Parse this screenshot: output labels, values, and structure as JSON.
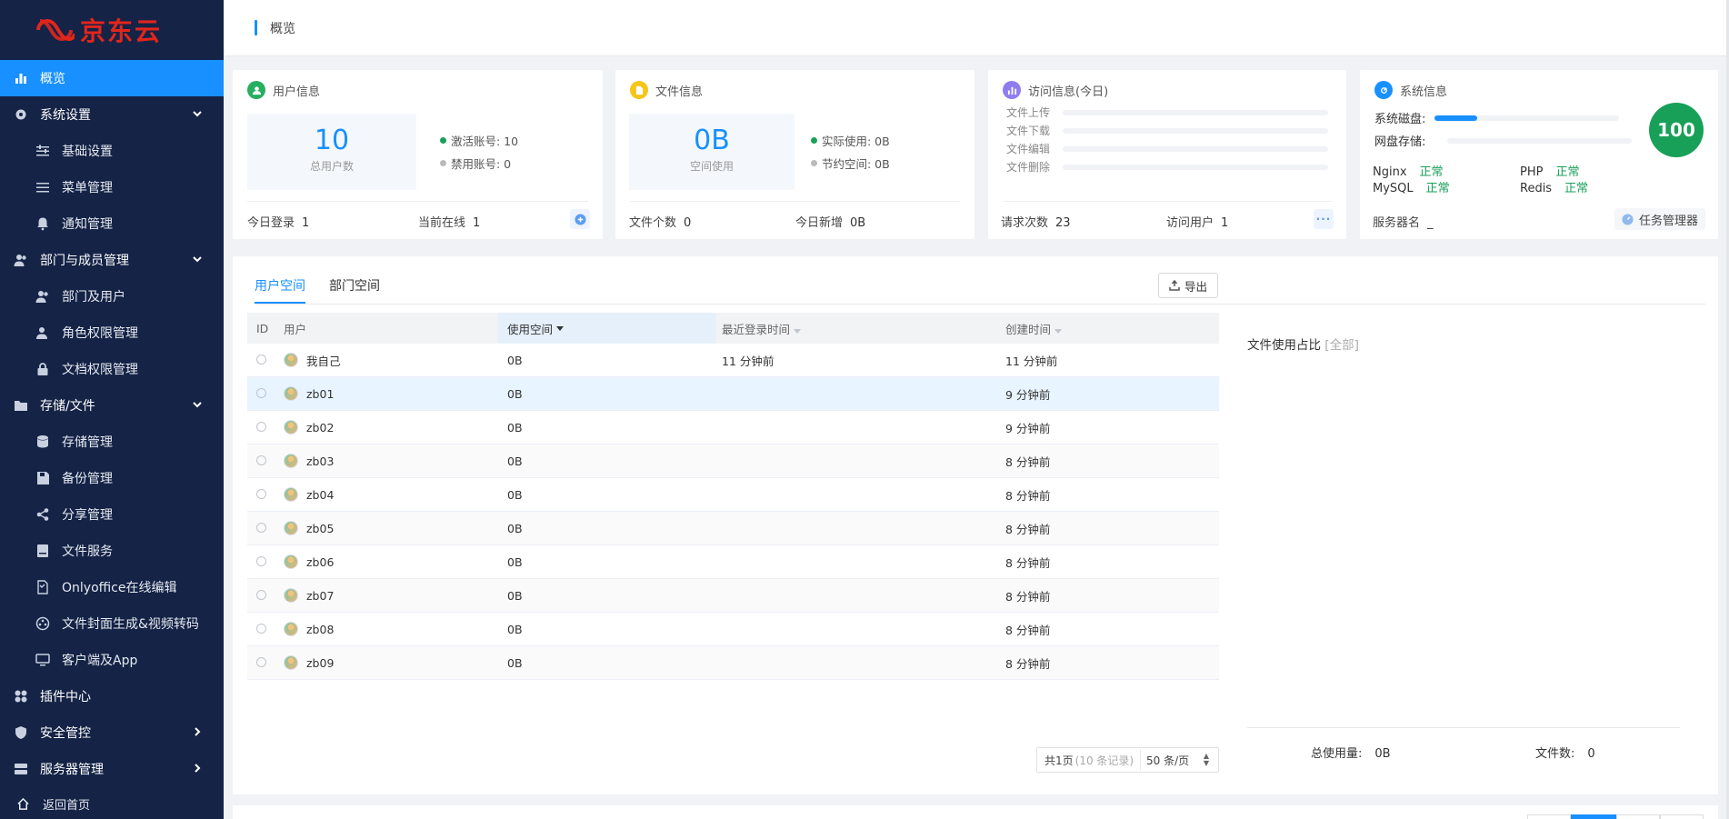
{
  "brand": {
    "name": "京东云",
    "color": "#e1261c"
  },
  "sidebar": {
    "items": [
      {
        "label": "概览",
        "icon": "bar-chart-icon",
        "active": true
      },
      {
        "label": "系统设置",
        "icon": "gear-icon",
        "expanded": true
      },
      {
        "label": "基础设置",
        "icon": "sliders-icon"
      },
      {
        "label": "菜单管理",
        "icon": "list-icon"
      },
      {
        "label": "通知管理",
        "icon": "bell-icon"
      },
      {
        "label": "部门与成员管理",
        "icon": "users-icon",
        "expanded": true
      },
      {
        "label": "部门及用户",
        "icon": "user-group-icon"
      },
      {
        "label": "角色权限管理",
        "icon": "user-shield-icon"
      },
      {
        "label": "文档权限管理",
        "icon": "lock-icon"
      },
      {
        "label": "存储/文件",
        "icon": "folder-icon",
        "expanded": true
      },
      {
        "label": "存储管理",
        "icon": "database-icon"
      },
      {
        "label": "备份管理",
        "icon": "save-icon"
      },
      {
        "label": "分享管理",
        "icon": "share-icon"
      },
      {
        "label": "文件服务",
        "icon": "hdd-icon"
      },
      {
        "label": "Onlyoffice在线编辑",
        "icon": "document-edit-icon"
      },
      {
        "label": "文件封面生成&视频转码",
        "icon": "film-icon"
      },
      {
        "label": "客户端及App",
        "icon": "monitor-icon"
      },
      {
        "label": "插件中心",
        "icon": "plugin-icon"
      },
      {
        "label": "安全管控",
        "icon": "shield-icon",
        "expanded": false
      },
      {
        "label": "服务器管理",
        "icon": "server-icon",
        "expanded": false
      }
    ],
    "back_home": "返回首页"
  },
  "header": {
    "title": "概览"
  },
  "cards": {
    "user": {
      "title": "用户信息",
      "total": "10",
      "total_label": "总用户数",
      "active_label": "激活账号: 10",
      "disabled_label": "禁用账号: 0",
      "today_login_label": "今日登录",
      "today_login": "1",
      "online_label": "当前在线",
      "online": "1"
    },
    "file": {
      "title": "文件信息",
      "space": "0B",
      "space_label": "空间使用",
      "actual_label": "实际使用: 0B",
      "saved_label": "节约空间: 0B",
      "count_label": "文件个数",
      "count": "0",
      "new_label": "今日新增",
      "new": "0B"
    },
    "access": {
      "title": "访问信息(今日)",
      "bars": [
        {
          "label": "文件上传",
          "value": 0
        },
        {
          "label": "文件下载",
          "value": 0
        },
        {
          "label": "文件编辑",
          "value": 0
        },
        {
          "label": "文件删除",
          "value": 0
        }
      ],
      "requests_label": "请求次数",
      "requests": "23",
      "visitors_label": "访问用户",
      "visitors": "1"
    },
    "system": {
      "title": "系统信息",
      "disk_label": "系统磁盘:",
      "disk_fill": 0.23,
      "netdisk_label": "网盘存储:",
      "netdisk_fill": 0,
      "services": [
        {
          "name": "Nginx",
          "status": "正常"
        },
        {
          "name": "PHP",
          "status": "正常"
        },
        {
          "name": "MySQL",
          "status": "正常"
        },
        {
          "name": "Redis",
          "status": "正常"
        }
      ],
      "score": "100",
      "server_label": "服务器名",
      "server_name": "_",
      "task_manager": "任务管理器"
    }
  },
  "main": {
    "tabs": [
      {
        "label": "用户空间",
        "active": true
      },
      {
        "label": "部门空间",
        "active": false
      }
    ],
    "export": "导出",
    "columns": [
      "ID",
      "用户",
      "使用空间",
      "最近登录时间",
      "创建时间"
    ],
    "rows": [
      {
        "user": "我自己",
        "used": "0B",
        "last": "11 分钟前",
        "created": "11 分钟前"
      },
      {
        "user": "zb01",
        "used": "0B",
        "last": "",
        "created": "9 分钟前"
      },
      {
        "user": "zb02",
        "used": "0B",
        "last": "",
        "created": "9 分钟前"
      },
      {
        "user": "zb03",
        "used": "0B",
        "last": "",
        "created": "8 分钟前"
      },
      {
        "user": "zb04",
        "used": "0B",
        "last": "",
        "created": "8 分钟前"
      },
      {
        "user": "zb05",
        "used": "0B",
        "last": "",
        "created": "8 分钟前"
      },
      {
        "user": "zb06",
        "used": "0B",
        "last": "",
        "created": "8 分钟前"
      },
      {
        "user": "zb07",
        "used": "0B",
        "last": "",
        "created": "8 分钟前"
      },
      {
        "user": "zb08",
        "used": "0B",
        "last": "",
        "created": "8 分钟前"
      },
      {
        "user": "zb09",
        "used": "0B",
        "last": "",
        "created": "8 分钟前"
      }
    ],
    "pager": {
      "pages": "共1页",
      "records": "(10 条记录)",
      "per_page": "50 条/页"
    },
    "panel": {
      "title": "文件使用占比",
      "filter": "[全部]",
      "total_label": "总使用量:",
      "total": "0B",
      "count_label": "文件数:",
      "count": "0"
    }
  },
  "colors": {
    "accent": "#1890ff",
    "sidebar_bg": "#142346",
    "ok": "#18a058",
    "user_icon": "#27ae60",
    "file_icon": "#f5c518",
    "access_icon": "#8e7cf0",
    "system_icon": "#1890ff"
  }
}
